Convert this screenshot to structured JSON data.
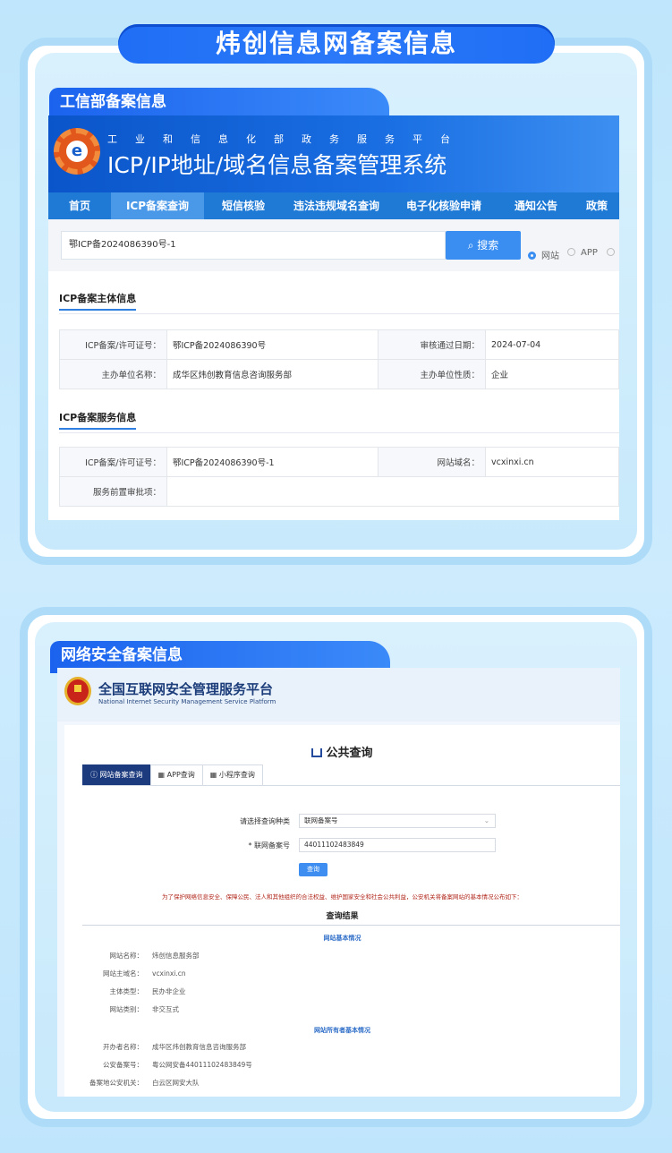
{
  "banner_title": "炜创信息网备案信息",
  "section1": {
    "label": "工信部备案信息",
    "site": {
      "subtitle": "工业和信息化部政务服务平台",
      "title": "ICP/IP地址/域名信息备案管理系统",
      "nav": [
        "首页",
        "ICP备案查询",
        "短信核验",
        "违法违规域名查询",
        "电子化核验申请",
        "通知公告",
        "政策"
      ],
      "nav_active": "ICP备案查询",
      "search_value": "鄂ICP备2024086390号-1",
      "search_button": "搜索",
      "radio_options": [
        "网站",
        "APP"
      ],
      "radio_selected": "网站",
      "main_section_title": "ICP备案主体信息",
      "main_rows": [
        {
          "k1": "ICP备案/许可证号：",
          "v1": "鄂ICP备2024086390号",
          "k2": "审核通过日期：",
          "v2": "2024-07-04"
        },
        {
          "k1": "主办单位名称：",
          "v1": "成华区炜创教育信息咨询服务部",
          "k2": "主办单位性质：",
          "v2": "企业"
        }
      ],
      "service_section_title": "ICP备案服务信息",
      "service_rows": [
        {
          "k1": "ICP备案/许可证号：",
          "v1": "鄂ICP备2024086390号-1",
          "k2": "网站域名：",
          "v2": "vcxinxi.cn"
        },
        {
          "k1": "服务前置审批项：",
          "v1": "",
          "k2": "",
          "v2": ""
        }
      ]
    }
  },
  "section2": {
    "label": "网络安全备案信息",
    "site": {
      "title": "全国互联网安全管理服务平台",
      "title_en": "National Internet Security Management Service Platform",
      "query_title": "公共查询",
      "tabs": [
        "网站备案查询",
        "APP查询",
        "小程序查询"
      ],
      "tab_active": "网站备案查询",
      "form": {
        "type_label": "请选择查询种类",
        "type_value": "联网备案号",
        "number_label": "* 联网备案号",
        "number_value": "44011102483849",
        "query_button": "查询"
      },
      "notice": "为了保护网络信息安全、保障公民、法人和其他组织的合法权益、维护国家安全和社会公共利益，公安机关将备案网站的基本情况公布如下：",
      "result_title": "查询结果",
      "basic_title": "网站基本情况",
      "basic_rows": [
        {
          "k": "网站名称：",
          "v": "炜创信息服务部"
        },
        {
          "k": "网站主域名：",
          "v": "vcxinxi.cn"
        },
        {
          "k": "主体类型：",
          "v": "民办非企业"
        },
        {
          "k": "网站类别：",
          "v": "非交互式"
        }
      ],
      "owner_title": "网站所有者基本情况",
      "owner_rows": [
        {
          "k": "开办者名称：",
          "v": "成华区炜创教育信息咨询服务部"
        },
        {
          "k": "公安备案号：",
          "v": "粤公网安备44011102483849号"
        },
        {
          "k": "备案地公安机关：",
          "v": "白云区网安大队"
        }
      ]
    }
  }
}
